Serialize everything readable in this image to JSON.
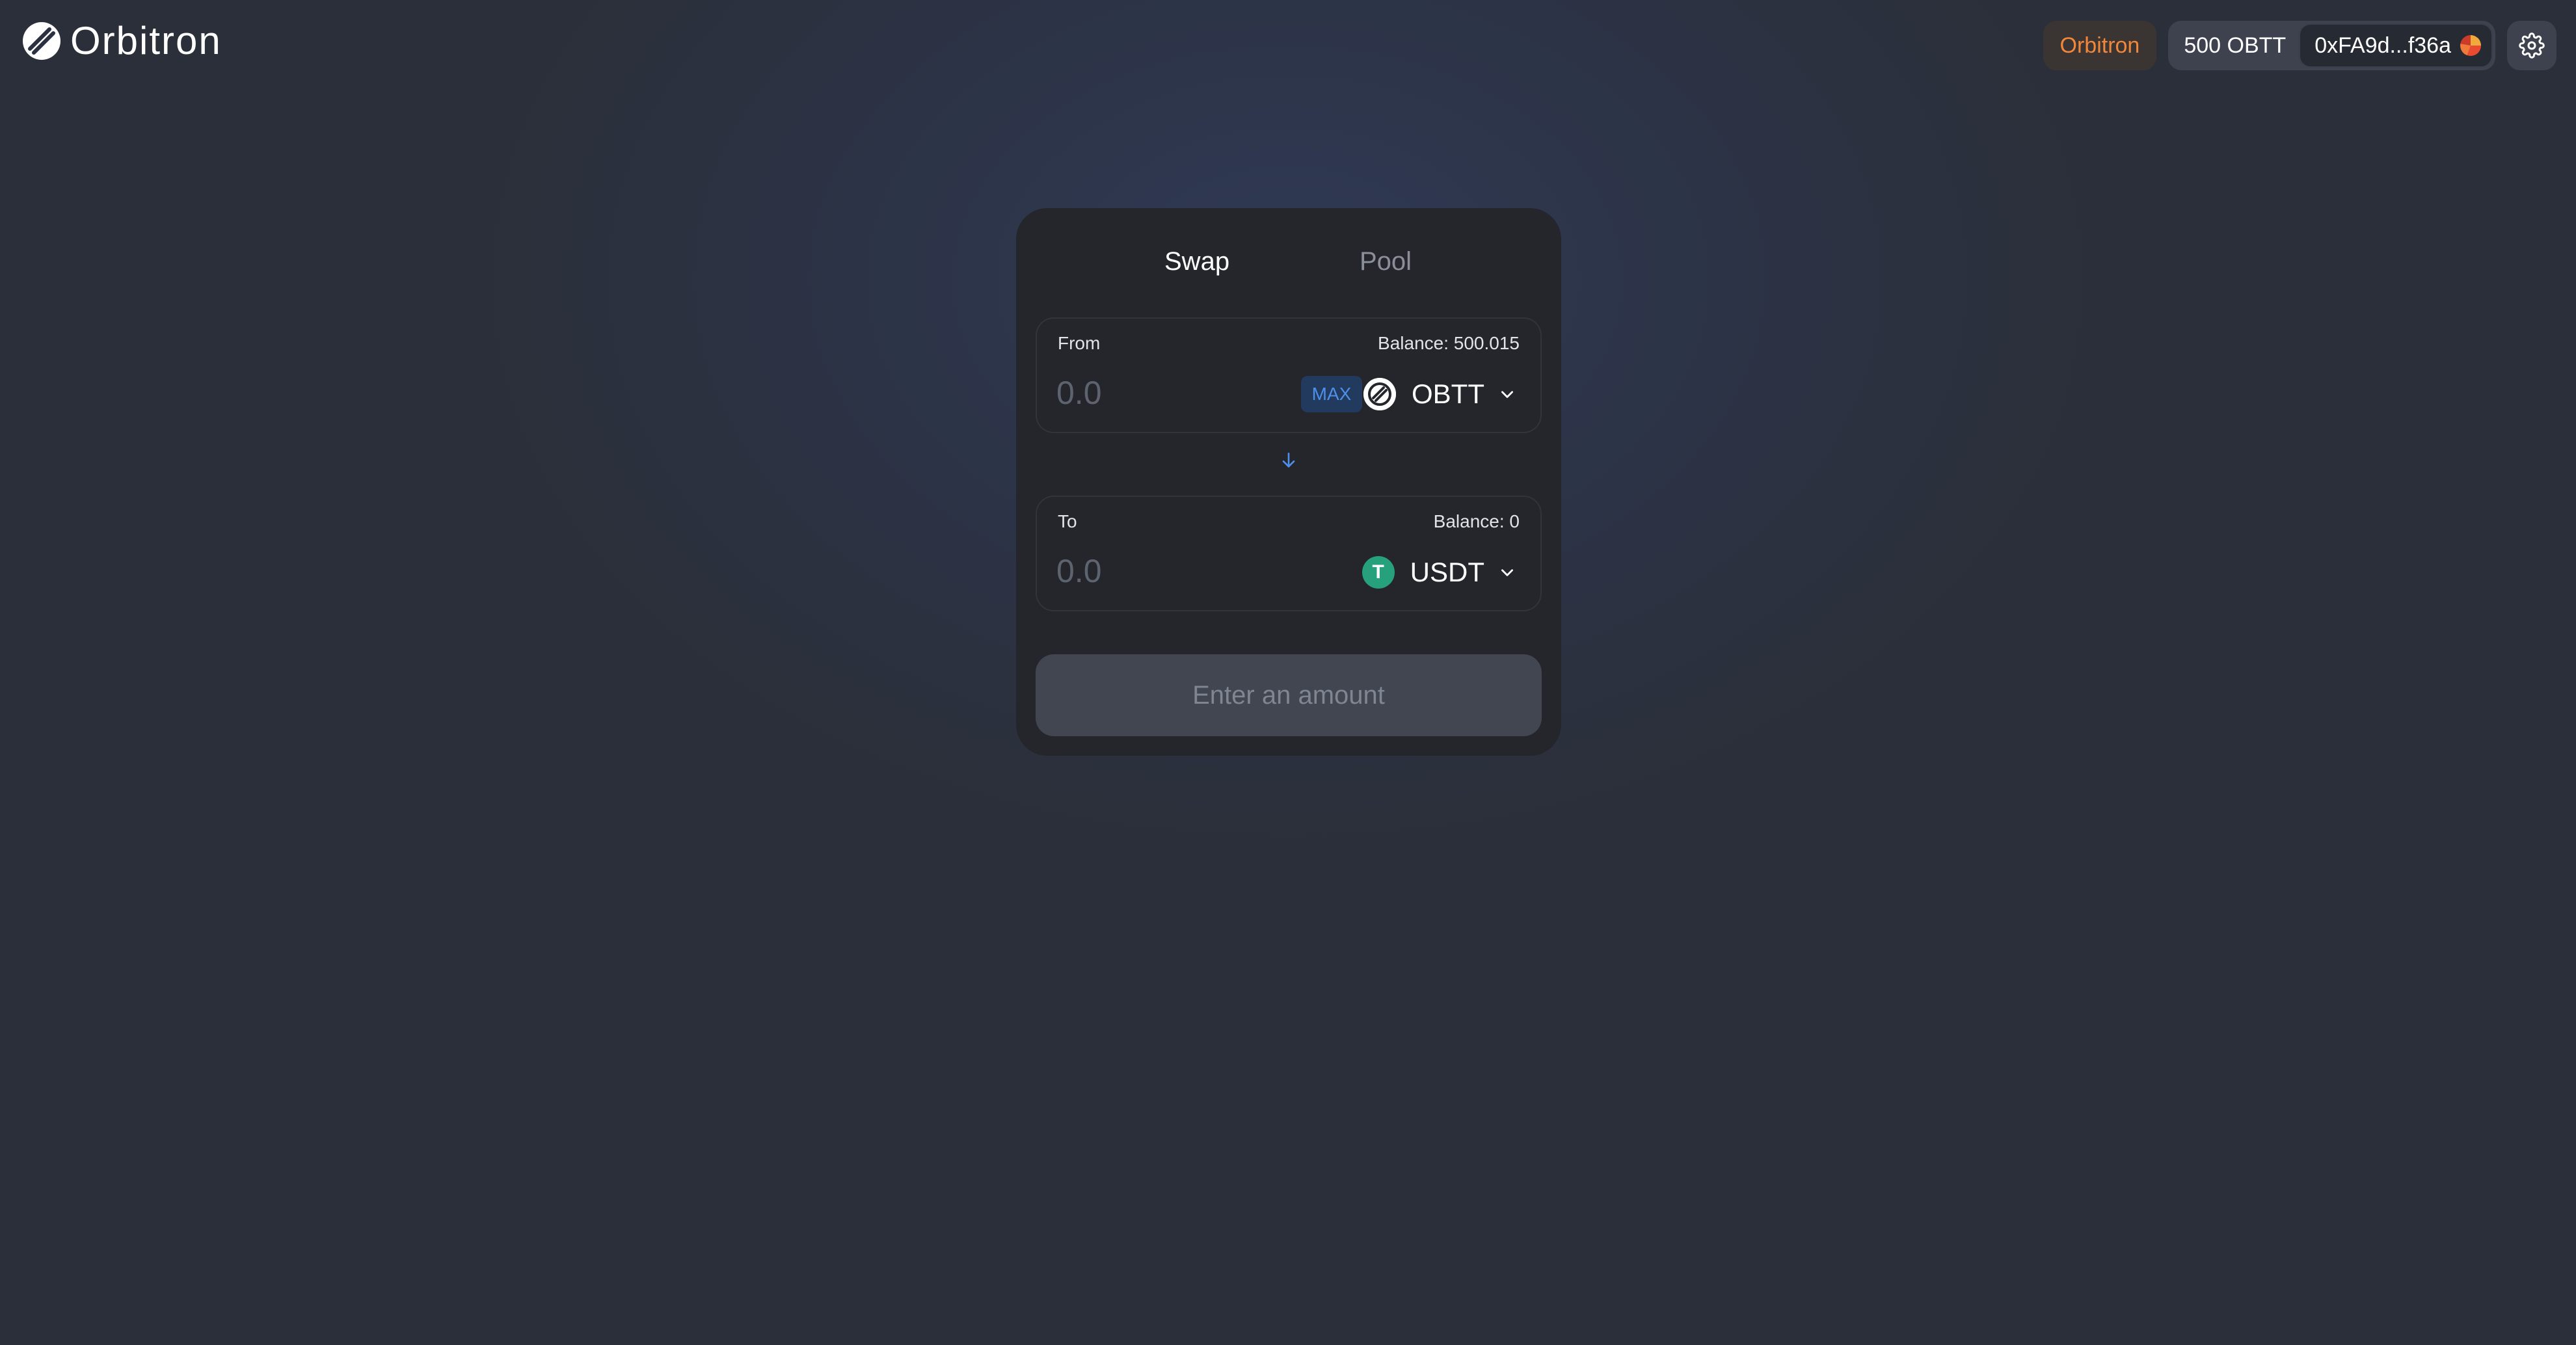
{
  "header": {
    "brand": "Orbitron",
    "network_label": "Orbitron",
    "balance": "500 OBTT",
    "address": "0xFA9d...f36a",
    "colors": {
      "network_accent": "#f2863b"
    }
  },
  "swap": {
    "tabs": [
      {
        "label": "Swap",
        "active": true
      },
      {
        "label": "Pool",
        "active": false
      }
    ],
    "from": {
      "label": "From",
      "balance": "Balance: 500.015",
      "placeholder": "0.0",
      "max_label": "MAX",
      "token": "OBTT",
      "token_icon": "obtt-logo-icon"
    },
    "to": {
      "label": "To",
      "balance": "Balance: 0",
      "placeholder": "0.0",
      "token": "USDT",
      "token_icon": "tether-icon",
      "token_glyph": "T"
    },
    "submit_label": "Enter an amount"
  }
}
